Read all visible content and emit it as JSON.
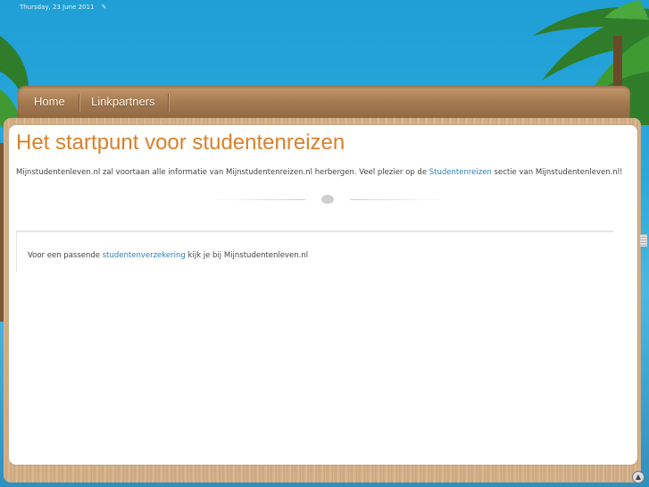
{
  "header": {
    "date": "Thursday, 23 June 2011"
  },
  "nav": {
    "items": [
      {
        "label": "Home"
      },
      {
        "label": "Linkpartners"
      }
    ]
  },
  "main": {
    "title": "Het startpunt voor studentenreizen",
    "intro_before_link": "Mijnstudentenleven.nl zal voortaan alle informatie van Mijnstudentenreizen.nl herbergen. Veel plezier op de ",
    "intro_link": "Studentenreizen",
    "intro_after_link": " sectie van Mijnstudentenleven.nl!",
    "box_before_link": "Voor een passende ",
    "box_link": "studentenverzekering",
    "box_after_link": " kijk je bij Mijnstudentenleven.nl"
  },
  "colors": {
    "title": "#d9812b",
    "link": "#2d7fb8",
    "nav_bg": "#a57a52",
    "sky": "#2aa8dc"
  },
  "icons": {
    "date_icon": "pencil-icon",
    "divider_icon": "shell-icon",
    "scroll_up_icon": "arrow-up-icon"
  }
}
